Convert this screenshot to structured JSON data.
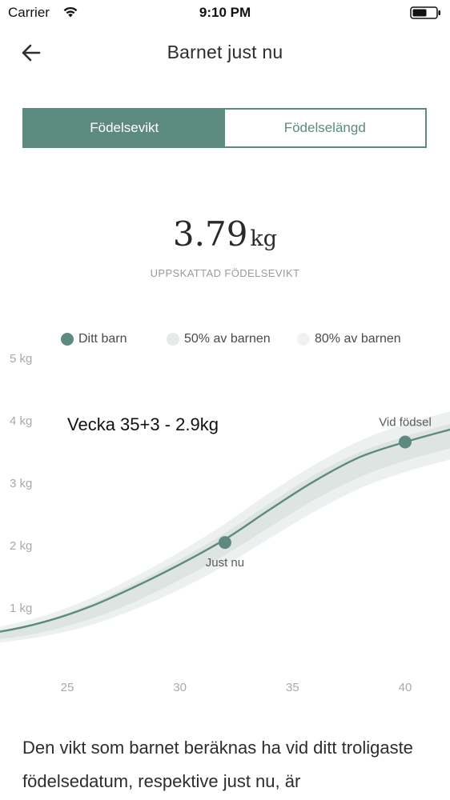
{
  "status_bar": {
    "carrier": "Carrier",
    "time": "9:10 PM"
  },
  "nav": {
    "title": "Barnet just nu",
    "back_icon": "arrow-left-icon"
  },
  "tabs": [
    {
      "label": "Födelsevikt",
      "active": true
    },
    {
      "label": "Födelselängd",
      "active": false
    }
  ],
  "estimate": {
    "value": "3.79",
    "unit": "kg",
    "caption": "UPPSKATTAD FÖDELSEVIKT"
  },
  "legend": [
    {
      "label": "Ditt barn",
      "color": "#5d8a7f"
    },
    {
      "label": "50% av barnen",
      "color": "#e6eae9"
    },
    {
      "label": "80% av barnen",
      "color": "#f1f3f2"
    }
  ],
  "colors": {
    "accent": "#5d8a7f",
    "band50": "#dde4e2",
    "band80": "#ecf0ef"
  },
  "chart_data": {
    "type": "area",
    "y_tick_labels": [
      "5 kg",
      "4 kg",
      "3 kg",
      "2 kg",
      "1 kg"
    ],
    "y_ticks": [
      5,
      4,
      3,
      2,
      1
    ],
    "x_ticks": [
      25,
      30,
      35,
      40
    ],
    "ylim": [
      0,
      5
    ],
    "xlim": [
      20,
      42
    ],
    "series": [
      {
        "name": "Ditt barn",
        "x": [
          20,
          22,
          24,
          26,
          28,
          30,
          32,
          34,
          36,
          38,
          40,
          42
        ],
        "y": [
          0.55,
          0.62,
          0.78,
          1.02,
          1.34,
          1.7,
          2.1,
          2.58,
          3.04,
          3.42,
          3.66,
          3.86
        ]
      }
    ],
    "band_80": {
      "x": [
        20,
        22,
        24,
        26,
        28,
        30,
        32,
        34,
        36,
        38,
        40,
        42
      ],
      "upper": [
        0.6,
        0.7,
        0.88,
        1.15,
        1.5,
        1.9,
        2.35,
        2.85,
        3.3,
        3.68,
        3.95,
        4.15
      ],
      "lower": [
        0.4,
        0.45,
        0.55,
        0.72,
        0.98,
        1.3,
        1.68,
        2.12,
        2.55,
        2.92,
        3.18,
        3.38
      ]
    },
    "band_50": {
      "x": [
        20,
        22,
        24,
        26,
        28,
        30,
        32,
        34,
        36,
        38,
        40,
        42
      ],
      "upper": [
        0.56,
        0.64,
        0.8,
        1.06,
        1.4,
        1.78,
        2.2,
        2.68,
        3.14,
        3.5,
        3.75,
        3.95
      ],
      "lower": [
        0.45,
        0.5,
        0.62,
        0.82,
        1.1,
        1.45,
        1.85,
        2.3,
        2.74,
        3.1,
        3.36,
        3.56
      ]
    },
    "points": [
      {
        "label": "Just nu",
        "x": 32,
        "y": 2.05
      },
      {
        "label": "Vid födsel",
        "x": 40,
        "y": 3.66
      }
    ],
    "annotation": "Vecka 35+3 - 2.9kg"
  },
  "body_text": "Den vikt som barnet beräknas ha vid ditt troligaste födelsedatum, respektive just nu, är"
}
